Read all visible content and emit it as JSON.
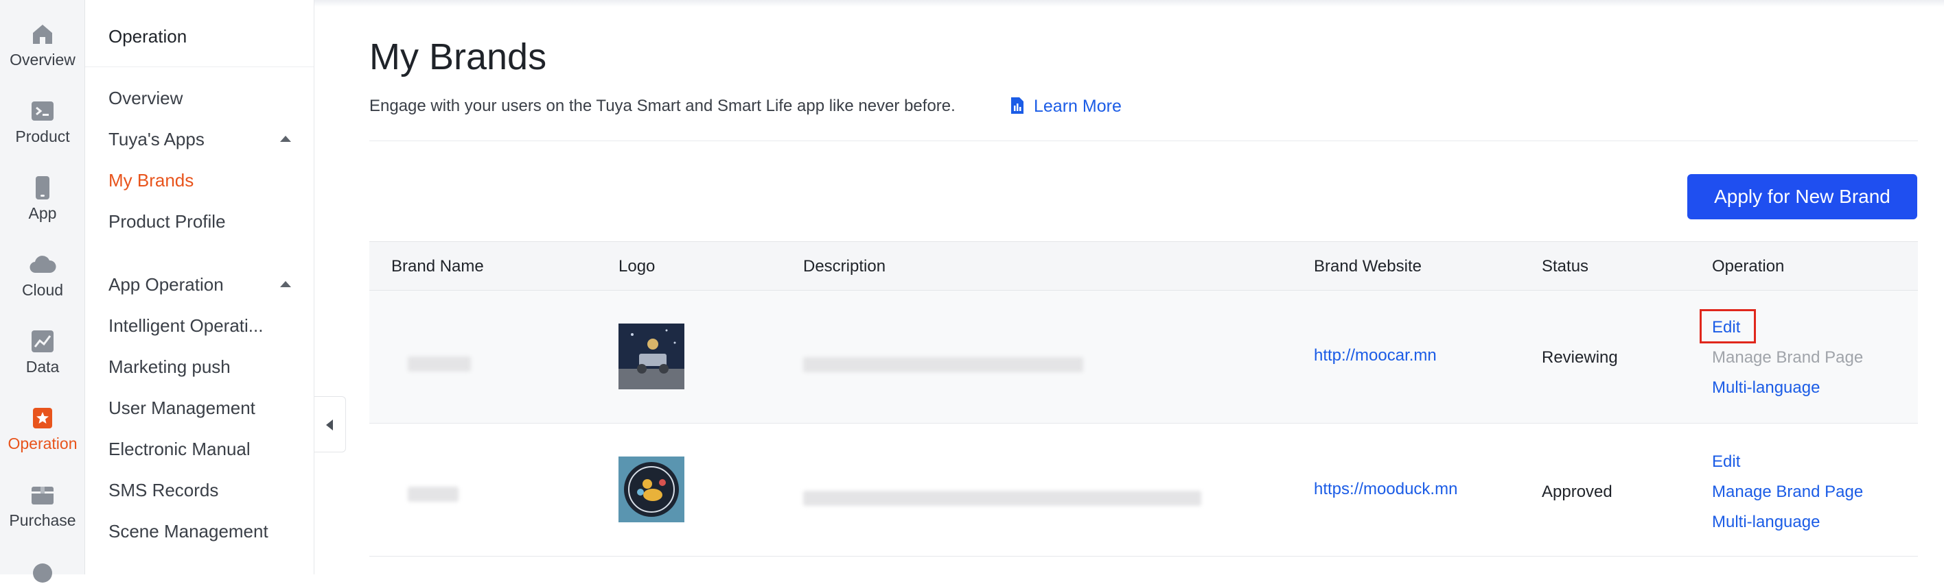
{
  "rail": {
    "items": [
      {
        "label": "Overview",
        "icon": "home-icon"
      },
      {
        "label": "Product",
        "icon": "terminal-icon"
      },
      {
        "label": "App",
        "icon": "phone-icon"
      },
      {
        "label": "Cloud",
        "icon": "cloud-icon"
      },
      {
        "label": "Data",
        "icon": "chart-icon"
      },
      {
        "label": "Operation",
        "icon": "operation-icon"
      },
      {
        "label": "Purchase",
        "icon": "box-icon"
      }
    ],
    "active_color": "#e8541c"
  },
  "sidebar": {
    "title": "Operation",
    "overview": "Overview",
    "tuyas_apps": "Tuya's Apps",
    "my_brands": "My Brands",
    "product_profile": "Product Profile",
    "app_operation": "App Operation",
    "intelligent_operation": "Intelligent Operati...",
    "marketing_push": "Marketing push",
    "user_management": "User Management",
    "electronic_manual": "Electronic Manual",
    "sms_records": "SMS Records",
    "scene_management": "Scene Management"
  },
  "header": {
    "title": "My Brands",
    "subtitle": "Engage with your users on the Tuya Smart and Smart Life app like never before.",
    "learn_more": "Learn More"
  },
  "toolbar": {
    "apply_label": "Apply for New Brand",
    "accent_color": "#1f4ff0"
  },
  "table": {
    "columns": [
      "Brand Name",
      "Logo",
      "Description",
      "Brand Website",
      "Status",
      "Operation"
    ],
    "rows": [
      {
        "website": "http://moocar.mn",
        "status": "Reviewing",
        "edit": "Edit",
        "manage": "Manage Brand Page",
        "multi": "Multi-language"
      },
      {
        "website": "https://mooduck.mn",
        "status": "Approved",
        "edit": "Edit",
        "manage": "Manage Brand Page",
        "multi": "Multi-language"
      }
    ]
  }
}
